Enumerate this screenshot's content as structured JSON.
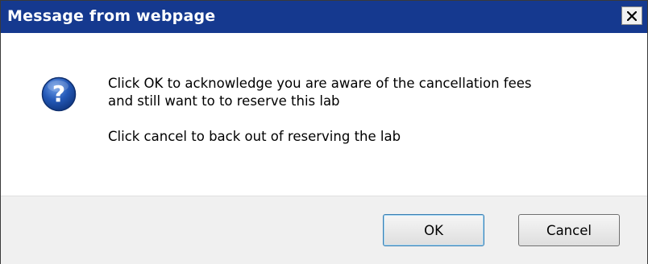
{
  "window": {
    "title": "Message from webpage",
    "close_glyph": "×"
  },
  "icon": {
    "name": "question-icon",
    "glyph": "?"
  },
  "message": {
    "line1": "Click OK to acknowledge you are aware of the cancellation fees",
    "line2": "and still want to to reserve this lab",
    "line3": "Click cancel to back out of reserving the lab"
  },
  "buttons": {
    "ok_label": "OK",
    "cancel_label": "Cancel"
  },
  "colors": {
    "titlebar": "#15398f",
    "icon_blue": "#2459b8",
    "footer": "#f0f0f0"
  }
}
